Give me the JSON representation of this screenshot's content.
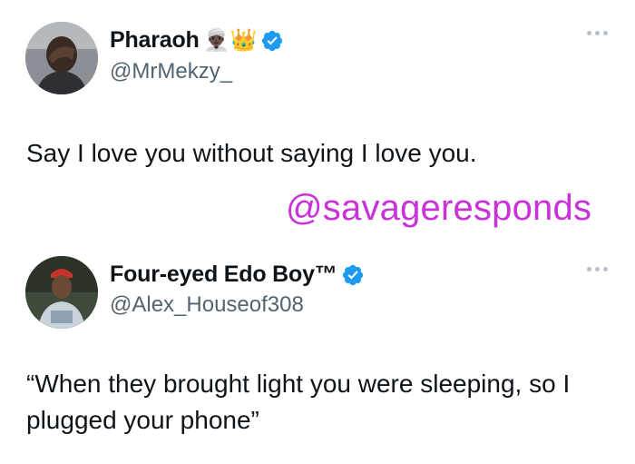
{
  "tweets": [
    {
      "display_name": "Pharaoh",
      "name_emojis": "👳🏿‍♂️👑",
      "handle": "@MrMekzy_",
      "text": "Say I love you without saying I love you."
    },
    {
      "display_name": "Four-eyed Edo Boy™",
      "handle": "@Alex_Houseof308",
      "text": "“When they brought light you were sleeping, so I plugged your phone”"
    }
  ],
  "watermark": "@savageresponds",
  "colors": {
    "verified": "#1d9bf0",
    "watermark": "#c931d9",
    "handle": "#536471"
  }
}
